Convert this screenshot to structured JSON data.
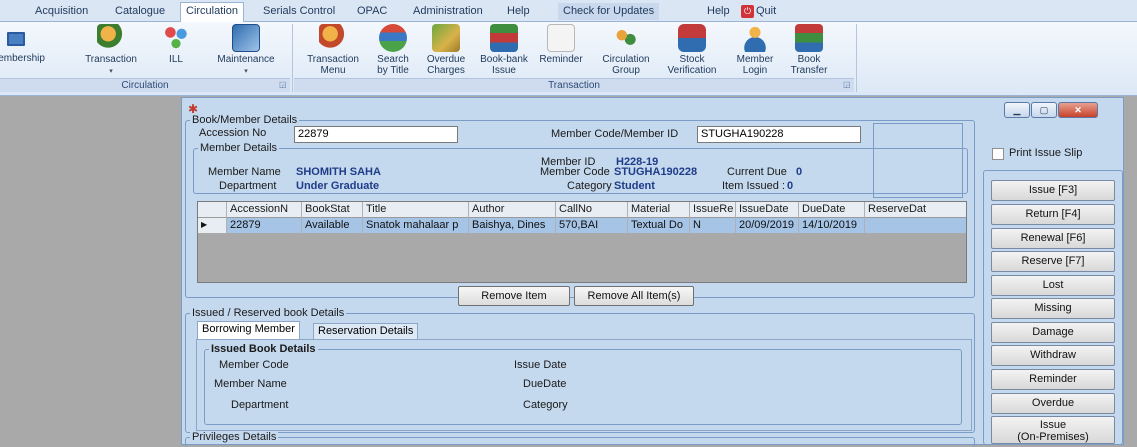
{
  "menubar": {
    "items": [
      "Acquisition",
      "Catalogue",
      "Circulation",
      "Serials Control",
      "OPAC",
      "Administration",
      "Help"
    ],
    "right": {
      "updates": "Check for Updates",
      "help": "Help",
      "quit": "Quit"
    }
  },
  "ribbon": {
    "circulation_group": {
      "label": "Circulation",
      "buttons": [
        {
          "label": "lembership",
          "icon": "membership-card-icon"
        },
        {
          "label": "Transaction",
          "icon": "transaction-icon"
        },
        {
          "label": "ILL",
          "icon": "ill-icon"
        },
        {
          "label": "Maintenance",
          "icon": "maintenance-icon"
        }
      ]
    },
    "transaction_group": {
      "label": "Transaction",
      "buttons": [
        {
          "line1": "Transaction",
          "line2": "Menu",
          "icon": "transaction-menu-icon"
        },
        {
          "line1": "Search",
          "line2": "by Title",
          "icon": "search-books-icon"
        },
        {
          "line1": "Overdue",
          "line2": "Charges",
          "icon": "overdue-charges-icon"
        },
        {
          "line1": "Book-bank",
          "line2": "Issue",
          "icon": "book-bank-icon"
        },
        {
          "line1": "Reminder",
          "line2": "",
          "icon": "reminder-icon"
        },
        {
          "line1": "Circulation",
          "line2": "Group",
          "icon": "circulation-group-icon"
        },
        {
          "line1": "Stock",
          "line2": "Verification",
          "icon": "stock-verification-icon"
        },
        {
          "line1": "Member",
          "line2": "Login",
          "icon": "member-login-icon"
        },
        {
          "line1": "Book",
          "line2": "Transfer",
          "icon": "book-transfer-icon"
        }
      ]
    }
  },
  "window": {
    "book_member": {
      "legend": "Book/Member Details",
      "accession_label": "Accession No",
      "accession_value": "22879",
      "member_code_label": "Member Code/Member ID",
      "member_code_value": "STUGHA190228"
    },
    "member_details": {
      "legend": "Member Details",
      "member_id_label": "Member ID",
      "member_id_value": "H228-19",
      "member_name_label": "Member Name",
      "member_name_value": "SHOMITH  SAHA",
      "member_code_label": "Member Code",
      "member_code_value": "STUGHA190228",
      "current_due_label": "Current Due",
      "current_due_value": "0",
      "department_label": "Department",
      "department_value": "Under Graduate",
      "category_label": "Category",
      "category_value": "Student",
      "items_issued_label": "Item Issued :",
      "items_issued_value": "0"
    },
    "print_issue_slip": "Print Issue Slip",
    "grid": {
      "columns": [
        "AccessionN",
        "BookStat",
        "Title",
        "Author",
        "CallNo",
        "Material",
        "IssueRe",
        "IssueDate",
        "DueDate",
        "ReserveDat"
      ],
      "rows": [
        [
          "22879",
          "Available",
          "Snatok mahalaar p",
          "Baishya, Dines",
          "570,BAI",
          "Textual Do",
          "N",
          "20/09/2019",
          "14/10/2019",
          ""
        ]
      ]
    },
    "remove_item": "Remove Item",
    "remove_all": "Remove All Item(s)",
    "issued_reserved": {
      "legend": "Issued / Reserved book Details",
      "tabs": [
        "Borrowing Member",
        "Reservation Details"
      ],
      "issued_book_details": "Issued Book Details",
      "member_code": "Member Code",
      "member_name": "Member Name",
      "department": "Department",
      "issue_date": "Issue Date",
      "due_date": "DueDate",
      "category": "Category"
    },
    "privileges": "Privileges Details",
    "actions": [
      "Issue [F3]",
      "Return [F4]",
      "Renewal [F6]",
      "Reserve [F7]",
      "Lost",
      "Missing",
      "Damage",
      "Withdraw",
      "Reminder",
      "Overdue"
    ],
    "issue_onprem_line1": "Issue",
    "issue_onprem_line2": "(On-Premises)"
  }
}
